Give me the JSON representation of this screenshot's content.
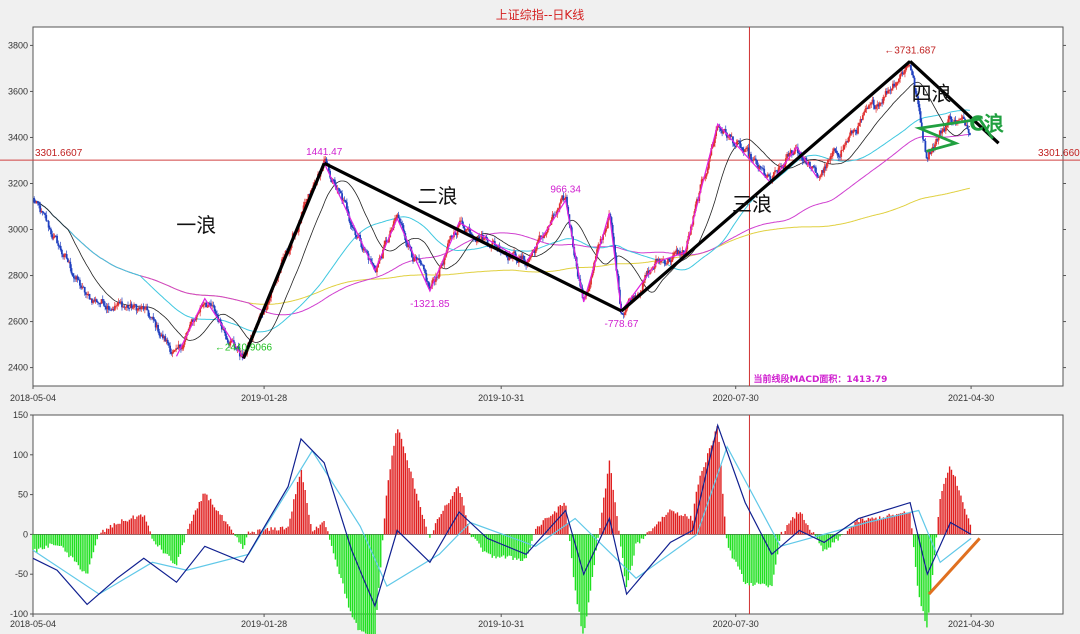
{
  "title": "上证综指--日K线",
  "chart_data": [
    {
      "type": "line",
      "title": "上证综指--日K线",
      "x_ticks": [
        "2018-05-04",
        "2019-01-28",
        "2019-10-31",
        "2020-07-30",
        "2021-04-30"
      ],
      "y_ticks": [
        2400,
        2600,
        2800,
        3000,
        3200,
        3400,
        3600,
        3800
      ],
      "ylim": [
        2320,
        3880
      ],
      "xlim": [
        "2018-05-04",
        "2021-08-15"
      ],
      "reference_line": {
        "value": 3301.6607,
        "label": "3301.6607",
        "color": "#d04040"
      },
      "cursor_date": "2020-08-15",
      "colors": {
        "up": "#e03030",
        "down": "#2040c0",
        "zigzag": "#e020e0",
        "wave": "#000000",
        "c_wave": "#20a040",
        "ma_long": "#e0d040",
        "ma_mid": "#40c8e0",
        "ma_short": "#222222",
        "ma_pink": "#d040d0"
      },
      "pivots": [
        {
          "date": "2018-05-04",
          "value": 3130
        },
        {
          "date": "2018-07-06",
          "value": 2700
        },
        {
          "date": "2018-09-10",
          "value": 2650
        },
        {
          "date": "2018-10-18",
          "value": 2449
        },
        {
          "date": "2018-11-20",
          "value": 2700
        },
        {
          "date": "2019-01-04",
          "value": 2440.9066
        },
        {
          "date": "2019-04-08",
          "value": 3288.45
        },
        {
          "date": "2019-06-06",
          "value": 2822
        },
        {
          "date": "2019-07-02",
          "value": 3048
        },
        {
          "date": "2019-08-09",
          "value": 2733
        },
        {
          "date": "2019-09-12",
          "value": 3031
        },
        {
          "date": "2019-11-29",
          "value": 2857
        },
        {
          "date": "2020-01-14",
          "value": 3127
        },
        {
          "date": "2020-02-04",
          "value": 2685
        },
        {
          "date": "2020-03-05",
          "value": 3071
        },
        {
          "date": "2020-03-19",
          "value": 2646
        },
        {
          "date": "2020-04-30",
          "value": 2860
        },
        {
          "date": "2020-06-01",
          "value": 2900
        },
        {
          "date": "2020-07-09",
          "value": 3458
        },
        {
          "date": "2020-09-09",
          "value": 3202
        },
        {
          "date": "2020-10-09",
          "value": 3358
        },
        {
          "date": "2020-11-02",
          "value": 3225
        },
        {
          "date": "2021-02-18",
          "value": 3731.687
        },
        {
          "date": "2021-03-09",
          "value": 3328
        },
        {
          "date": "2021-04-06",
          "value": 3484
        },
        {
          "date": "2021-04-30",
          "value": 3446
        }
      ],
      "wave_lines": [
        {
          "name": "一浪",
          "from": {
            "date": "2019-01-04",
            "value": 2440
          },
          "to": {
            "date": "2019-04-08",
            "value": 3288
          }
        },
        {
          "name": "二浪",
          "from": {
            "date": "2019-04-08",
            "value": 3288
          },
          "to": {
            "date": "2020-03-19",
            "value": 2646
          }
        },
        {
          "name": "三浪",
          "from": {
            "date": "2020-03-19",
            "value": 2646
          },
          "to": {
            "date": "2021-02-18",
            "value": 3731
          }
        },
        {
          "name": "四浪",
          "from": {
            "date": "2021-02-18",
            "value": 3731
          },
          "to": {
            "date": "2021-06-01",
            "value": 3375
          }
        }
      ],
      "c_wave_points": [
        {
          "date": "2021-03-09",
          "value": 3340
        },
        {
          "date": "2021-04-12",
          "value": 3375
        },
        {
          "date": "2021-03-01",
          "value": 3440
        },
        {
          "date": "2021-05-10",
          "value": 3480
        },
        {
          "date": "2021-05-25",
          "value": 3395
        }
      ],
      "annotations": [
        {
          "text": "1441.47",
          "date": "2019-04-08",
          "value": 3288,
          "style": "m"
        },
        {
          "text": "966.34",
          "date": "2020-01-14",
          "value": 3127,
          "style": "m"
        },
        {
          "text": "-1321.85",
          "date": "2019-08-09",
          "value": 2733,
          "style": "m"
        },
        {
          "text": "-778.67",
          "date": "2020-03-19",
          "value": 2646,
          "style": "m"
        },
        {
          "text": "←2440.9066",
          "date": "2019-01-04",
          "value": 2440,
          "style": "g"
        },
        {
          "text": "←3731.687",
          "date": "2021-02-18",
          "value": 3731,
          "style": "r"
        }
      ],
      "wave_labels": [
        {
          "text": "一浪",
          "date": "2018-11-10",
          "value": 2990
        },
        {
          "text": "二浪",
          "date": "2019-08-18",
          "value": 3115
        },
        {
          "text": "三浪",
          "date": "2020-08-18",
          "value": 3080
        },
        {
          "text": "四浪",
          "date": "2021-03-15",
          "value": 3560
        },
        {
          "text": "C浪",
          "date": "2021-05-18",
          "value": 3430
        }
      ],
      "macd_area_note": "当前线段MACD面积：1413.79"
    },
    {
      "type": "bar",
      "name": "MACD",
      "x_ticks": [
        "2018-05-04",
        "2019-01-28",
        "2019-10-31",
        "2020-07-30",
        "2021-04-30"
      ],
      "y_ticks": [
        -100,
        -50,
        0,
        50,
        100,
        150
      ],
      "ylim": [
        -100,
        150
      ],
      "cursor_date": "2020-08-15",
      "colors": {
        "pos": "#e02020",
        "neg": "#20e020",
        "dif": "#102090",
        "dea": "#60c8e8",
        "trend": "#e07020"
      },
      "dif": [
        {
          "date": "2018-05-04",
          "value": -30
        },
        {
          "date": "2018-06-01",
          "value": -45
        },
        {
          "date": "2018-07-06",
          "value": -88
        },
        {
          "date": "2018-08-10",
          "value": -55
        },
        {
          "date": "2018-09-10",
          "value": -30
        },
        {
          "date": "2018-10-18",
          "value": -60
        },
        {
          "date": "2018-11-20",
          "value": -15
        },
        {
          "date": "2019-01-04",
          "value": -35
        },
        {
          "date": "2019-02-25",
          "value": 60
        },
        {
          "date": "2019-03-12",
          "value": 120
        },
        {
          "date": "2019-04-08",
          "value": 90
        },
        {
          "date": "2019-05-10",
          "value": -20
        },
        {
          "date": "2019-06-06",
          "value": -90
        },
        {
          "date": "2019-07-02",
          "value": 5
        },
        {
          "date": "2019-08-09",
          "value": -35
        },
        {
          "date": "2019-09-12",
          "value": 28
        },
        {
          "date": "2019-10-15",
          "value": -5
        },
        {
          "date": "2019-11-29",
          "value": -25
        },
        {
          "date": "2020-01-14",
          "value": 30
        },
        {
          "date": "2020-02-04",
          "value": -50
        },
        {
          "date": "2020-03-05",
          "value": 20
        },
        {
          "date": "2020-03-25",
          "value": -75
        },
        {
          "date": "2020-05-15",
          "value": -10
        },
        {
          "date": "2020-06-10",
          "value": 5
        },
        {
          "date": "2020-07-09",
          "value": 137
        },
        {
          "date": "2020-08-10",
          "value": 40
        },
        {
          "date": "2020-09-10",
          "value": -25
        },
        {
          "date": "2020-10-12",
          "value": 5
        },
        {
          "date": "2020-11-10",
          "value": -10
        },
        {
          "date": "2020-12-20",
          "value": 20
        },
        {
          "date": "2021-02-18",
          "value": 40
        },
        {
          "date": "2021-03-10",
          "value": -50
        },
        {
          "date": "2021-04-06",
          "value": 15
        },
        {
          "date": "2021-04-30",
          "value": 0
        }
      ],
      "dea": [
        {
          "date": "2018-05-04",
          "value": -20
        },
        {
          "date": "2018-07-20",
          "value": -75
        },
        {
          "date": "2018-09-20",
          "value": -35
        },
        {
          "date": "2018-10-30",
          "value": -45
        },
        {
          "date": "2019-01-10",
          "value": -25
        },
        {
          "date": "2019-03-25",
          "value": 105
        },
        {
          "date": "2019-05-20",
          "value": 10
        },
        {
          "date": "2019-06-20",
          "value": -65
        },
        {
          "date": "2019-08-20",
          "value": -25
        },
        {
          "date": "2019-09-25",
          "value": 15
        },
        {
          "date": "2019-12-10",
          "value": -15
        },
        {
          "date": "2020-01-25",
          "value": 20
        },
        {
          "date": "2020-04-05",
          "value": -55
        },
        {
          "date": "2020-06-15",
          "value": 0
        },
        {
          "date": "2020-07-20",
          "value": 110
        },
        {
          "date": "2020-09-20",
          "value": -15
        },
        {
          "date": "2020-12-30",
          "value": 15
        },
        {
          "date": "2021-02-28",
          "value": 30
        },
        {
          "date": "2021-03-25",
          "value": -35
        },
        {
          "date": "2021-04-30",
          "value": -5
        }
      ],
      "trend_line": {
        "from": {
          "date": "2021-03-12",
          "value": -75
        },
        "to": {
          "date": "2021-05-10",
          "value": -5
        }
      }
    }
  ]
}
